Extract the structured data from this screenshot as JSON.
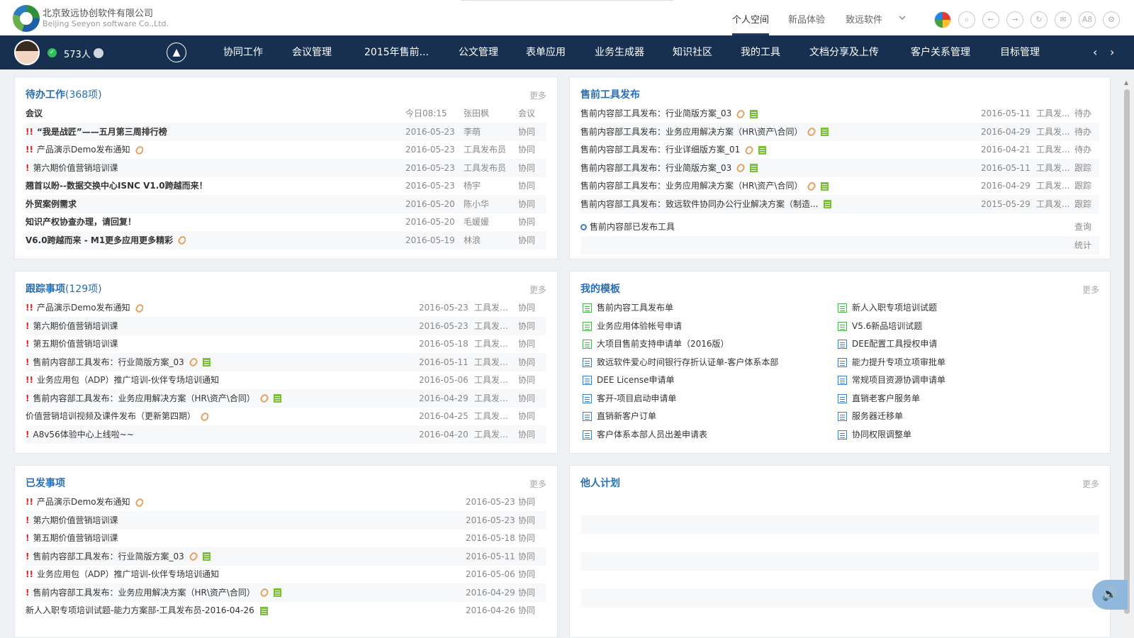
{
  "header": {
    "company_cn": "北京致远协创软件有限公司",
    "company_en": "Beijing Seeyon software Co.,Ltd.",
    "nav": [
      "个人空间",
      "新品体验",
      "致远软件"
    ],
    "icons": [
      "color-wheel-icon",
      "search-icon",
      "back-icon",
      "forward-icon",
      "refresh-icon",
      "mail-icon",
      "a8-icon",
      "gear-icon"
    ],
    "a8_label": "A8"
  },
  "navbar": {
    "online_count": "573人",
    "items": [
      "协同工作",
      "会议管理",
      "2015年售前...",
      "公文管理",
      "表单应用",
      "业务生成器",
      "知识社区",
      "我的工具",
      "文档分享及上传",
      "客户关系管理",
      "目标管理"
    ],
    "prev": "‹",
    "next": "›",
    "bg_color": "#17304f"
  },
  "pending": {
    "title": "待办工作",
    "count": "(368项)",
    "more": "更多",
    "rows": [
      {
        "title": "会议",
        "bold": true,
        "imp": "",
        "date": "今日08:15",
        "person": "张田枫",
        "type": "会议"
      },
      {
        "title": "“我是战匠”——五月第三周排行榜",
        "bold": true,
        "imp": "!!",
        "date": "2016-05-23",
        "person": "李萌",
        "type": "协同"
      },
      {
        "title": "产品演示Demo发布通知",
        "bold": false,
        "imp": "!!",
        "clip": true,
        "date": "2016-05-23",
        "person": "工具发布员",
        "type": "协同"
      },
      {
        "title": "第六期价值营销培训课",
        "bold": false,
        "imp": "!",
        "date": "2016-05-23",
        "person": "工具发布员",
        "type": "协同"
      },
      {
        "title": "翘首以盼--数据交换中心ISNC V1.0跨越而来！",
        "bold": true,
        "imp": "",
        "date": "2016-05-23",
        "person": "杨宇",
        "type": "协同"
      },
      {
        "title": "外贸案例需求",
        "bold": true,
        "imp": "",
        "date": "2016-05-20",
        "person": "陈小华",
        "type": "协同"
      },
      {
        "title": "知识产权协查办理，请回复！",
        "bold": true,
        "imp": "",
        "date": "2016-05-20",
        "person": "毛媛媛",
        "type": "协同"
      },
      {
        "title": "V6.0跨越而来 - M1更多应用更多精彩",
        "bold": true,
        "imp": "",
        "clip": true,
        "date": "2016-05-19",
        "person": "林浪",
        "type": "协同"
      }
    ]
  },
  "presale": {
    "title": "售前工具发布",
    "more": "",
    "rows": [
      {
        "title": "售前内容部工具发布：行业简版方案_03",
        "clip": true,
        "doc": true,
        "date": "2016-05-11",
        "person": "工具发...",
        "status": "待办"
      },
      {
        "title": "售前内容部工具发布：业务应用解决方案（HR\\资产\\合同）",
        "clip": true,
        "doc": true,
        "date": "2016-04-29",
        "person": "工具发...",
        "status": "待办"
      },
      {
        "title": "售前内容部工具发布：行业详细版方案_01",
        "clip": true,
        "doc": true,
        "date": "2016-04-21",
        "person": "工具发...",
        "status": "待办"
      },
      {
        "title": "售前内容部工具发布：行业简版方案_03",
        "clip": true,
        "doc": true,
        "date": "2016-05-11",
        "person": "工具发...",
        "status": "跟踪"
      },
      {
        "title": "售前内容部工具发布：业务应用解决方案（HR\\资产\\合同）",
        "clip": true,
        "doc": true,
        "date": "2016-04-29",
        "person": "工具发...",
        "status": "跟踪"
      },
      {
        "title": "售前内容部工具发布：致远软件协同办公行业解决方案（制造...",
        "clip": false,
        "doc": true,
        "date": "2015-05-29",
        "person": "工具发...",
        "status": "跟踪"
      }
    ],
    "search_label": "售前内容部已发布工具",
    "query": "查询",
    "stats": "统计"
  },
  "tracking": {
    "title": "跟踪事项",
    "count": "(129项)",
    "more": "更多",
    "rows": [
      {
        "title": "产品演示Demo发布通知",
        "imp": "!!",
        "clip": true,
        "doc": false,
        "date": "2016-05-23",
        "person": "工具发布...",
        "type": "协同"
      },
      {
        "title": "第六期价值营销培训课",
        "imp": "!",
        "clip": false,
        "doc": false,
        "date": "2016-05-23",
        "person": "工具发布...",
        "type": "协同"
      },
      {
        "title": "第五期价值营销培训课",
        "imp": "!",
        "clip": false,
        "doc": false,
        "date": "2016-05-18",
        "person": "工具发布...",
        "type": "协同"
      },
      {
        "title": "售前内容部工具发布：行业简版方案_03",
        "imp": "!",
        "clip": true,
        "doc": true,
        "date": "2016-05-11",
        "person": "工具发布...",
        "type": "协同"
      },
      {
        "title": "业务应用包（ADP）推广培训-伙伴专场培训通知",
        "imp": "!!",
        "clip": false,
        "doc": false,
        "date": "2016-05-06",
        "person": "工具发布...",
        "type": "协同"
      },
      {
        "title": "售前内容部工具发布：业务应用解决方案（HR\\资产\\合同）",
        "imp": "!",
        "clip": true,
        "doc": true,
        "date": "2016-04-29",
        "person": "工具发布...",
        "type": "协同"
      },
      {
        "title": "价值营销培训视频及课件发布（更新第四期）",
        "imp": "",
        "clip": true,
        "doc": false,
        "date": "2016-04-25",
        "person": "工具发布...",
        "type": "协同"
      },
      {
        "title": "A8v56体验中心上线啦~~",
        "imp": "!",
        "clip": false,
        "doc": false,
        "date": "2016-04-20",
        "person": "工具发布...",
        "type": "协同"
      }
    ]
  },
  "templates": {
    "title": "我的模板",
    "more": "更多",
    "left": [
      {
        "label": "售前内容工具发布单",
        "green": true
      },
      {
        "label": "业务应用体验帐号申请",
        "green": true
      },
      {
        "label": "大项目售前支持申请单（2016版）",
        "green": true
      },
      {
        "label": "致远软件爱心时间银行存折认证单-客户体系本部",
        "green": false
      },
      {
        "label": "DEE License申请单",
        "green": false
      },
      {
        "label": "客开-项目启动申请单",
        "green": false
      },
      {
        "label": "直销新客户订单",
        "green": false
      },
      {
        "label": "客户体系本部人员出差申请表",
        "green": false
      }
    ],
    "right": [
      {
        "label": "新人入职专项培训试题",
        "green": true
      },
      {
        "label": "V5.6新品培训试题",
        "green": true
      },
      {
        "label": "DEE配置工具授权申请",
        "green": false
      },
      {
        "label": "能力提升专项立项审批单",
        "green": false
      },
      {
        "label": "常规项目资源协调申请单",
        "green": false
      },
      {
        "label": "直销老客户服务单",
        "green": false
      },
      {
        "label": "服务器迁移单",
        "green": false
      },
      {
        "label": "协同权限调整单",
        "green": false
      }
    ]
  },
  "sent": {
    "title": "已发事项",
    "more": "更多",
    "rows": [
      {
        "title": "产品演示Demo发布通知",
        "imp": "!!",
        "clip": true,
        "doc": false,
        "date": "2016-05-23",
        "type": "协同"
      },
      {
        "title": "第六期价值营销培训课",
        "imp": "!",
        "clip": false,
        "doc": false,
        "date": "2016-05-23",
        "type": "协同"
      },
      {
        "title": "第五期价值营销培训课",
        "imp": "!",
        "clip": false,
        "doc": false,
        "date": "2016-05-18",
        "type": "协同"
      },
      {
        "title": "售前内容部工具发布：行业简版方案_03",
        "imp": "!",
        "clip": true,
        "doc": true,
        "date": "2016-05-11",
        "type": "协同"
      },
      {
        "title": "业务应用包（ADP）推广培训-伙伴专场培训通知",
        "imp": "!!",
        "clip": false,
        "doc": false,
        "date": "2016-05-06",
        "type": "协同"
      },
      {
        "title": "售前内容部工具发布：业务应用解决方案（HR\\资产\\合同）",
        "imp": "!",
        "clip": true,
        "doc": true,
        "date": "2016-04-29",
        "type": "协同"
      },
      {
        "title": "新人入职专项培训试题-能力方案部-工具发布员-2016-04-26",
        "imp": "",
        "clip": false,
        "doc": true,
        "date": "2016-04-26",
        "type": "协同"
      }
    ]
  },
  "others_plan": {
    "title": "他人计划",
    "more": "更多"
  },
  "colors": {
    "accent": "#2a6fb5",
    "important": "#e02020"
  }
}
